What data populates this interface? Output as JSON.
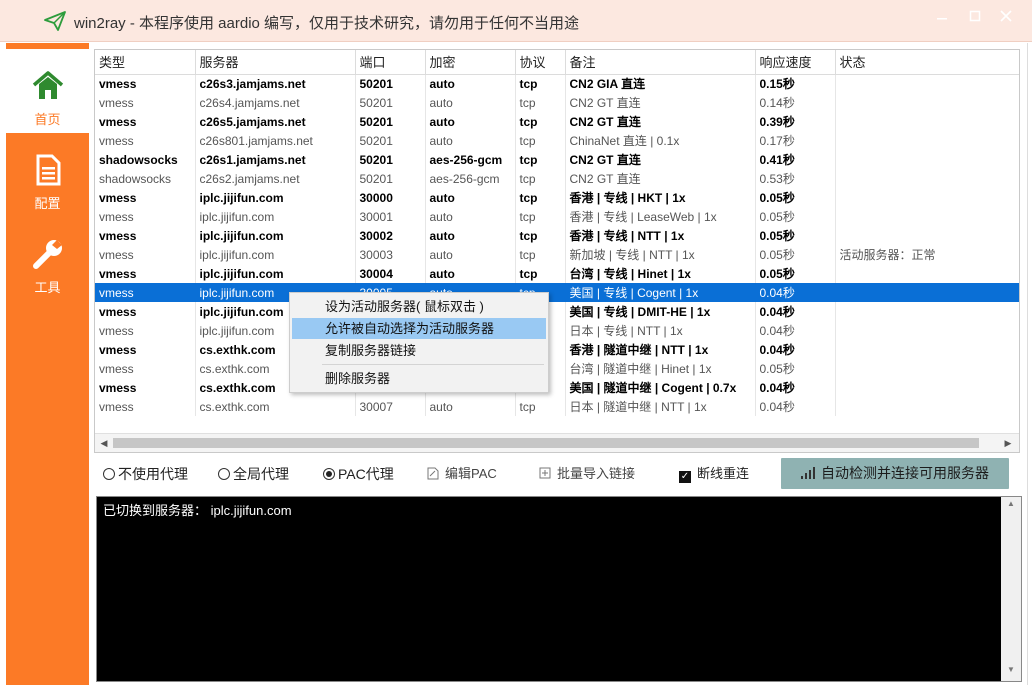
{
  "window": {
    "title": "win2ray - 本程序使用 aardio 编写，仅用于技术研究，请勿用于任何不当用途",
    "min_icon": "minimize-icon",
    "max_icon": "maximize-icon",
    "close_icon": "close-icon",
    "accent": "#fc7a26"
  },
  "sidebar": {
    "items": [
      {
        "label": "首页",
        "icon": "home-icon",
        "active": true
      },
      {
        "label": "配置",
        "icon": "document-icon",
        "active": false
      },
      {
        "label": "工具",
        "icon": "wrench-icon",
        "active": false
      }
    ]
  },
  "table": {
    "columns": [
      "类型",
      "服务器",
      "端口",
      "加密",
      "协议",
      "备注",
      "响应速度",
      "状态"
    ],
    "rows": [
      [
        "vmess",
        "c26s3.jamjams.net",
        "50201",
        "auto",
        "tcp",
        "CN2 GIA 直连",
        "0.15秒",
        ""
      ],
      [
        "vmess",
        "c26s4.jamjams.net",
        "50201",
        "auto",
        "tcp",
        "CN2 GT 直连",
        "0.14秒",
        ""
      ],
      [
        "vmess",
        "c26s5.jamjams.net",
        "50201",
        "auto",
        "tcp",
        "CN2 GT 直连",
        "0.39秒",
        ""
      ],
      [
        "vmess",
        "c26s801.jamjams.net",
        "50201",
        "auto",
        "tcp",
        "ChinaNet 直连 | 0.1x",
        "0.17秒",
        ""
      ],
      [
        "shadowsocks",
        "c26s1.jamjams.net",
        "50201",
        "aes-256-gcm",
        "tcp",
        "CN2 GT 直连",
        "0.41秒",
        ""
      ],
      [
        "shadowsocks",
        "c26s2.jamjams.net",
        "50201",
        "aes-256-gcm",
        "tcp",
        "CN2 GT 直连",
        "0.53秒",
        ""
      ],
      [
        "vmess",
        "iplc.jijifun.com",
        "30000",
        "auto",
        "tcp",
        "香港 | 专线 | HKT | 1x",
        "0.05秒",
        ""
      ],
      [
        "vmess",
        "iplc.jijifun.com",
        "30001",
        "auto",
        "tcp",
        "香港 | 专线 | LeaseWeb | 1x",
        "0.05秒",
        ""
      ],
      [
        "vmess",
        "iplc.jijifun.com",
        "30002",
        "auto",
        "tcp",
        "香港 | 专线 | NTT | 1x",
        "0.05秒",
        ""
      ],
      [
        "vmess",
        "iplc.jijifun.com",
        "30003",
        "auto",
        "tcp",
        "新加坡 | 专线 | NTT | 1x",
        "0.05秒",
        "活动服务器：正常"
      ],
      [
        "vmess",
        "iplc.jijifun.com",
        "30004",
        "auto",
        "tcp",
        "台湾 | 专线 | Hinet | 1x",
        "0.05秒",
        ""
      ],
      [
        "vmess",
        "iplc.jijifun.com",
        "30005",
        "auto",
        "tcp",
        "美国 | 专线 | Cogent | 1x",
        "0.04秒",
        ""
      ],
      [
        "vmess",
        "iplc.jijifun.com",
        "",
        "",
        "",
        "美国 | 专线 | DMIT-HE | 1x",
        "0.04秒",
        ""
      ],
      [
        "vmess",
        "iplc.jijifun.com",
        "",
        "",
        "",
        "日本 | 专线 | NTT | 1x",
        "0.04秒",
        ""
      ],
      [
        "vmess",
        "cs.exthk.com",
        "",
        "",
        "",
        "香港 | 隧道中继 | NTT | 1x",
        "0.04秒",
        ""
      ],
      [
        "vmess",
        "cs.exthk.com",
        "",
        "",
        "",
        "台湾 | 隧道中继 | Hinet | 1x",
        "0.05秒",
        ""
      ],
      [
        "vmess",
        "cs.exthk.com",
        "",
        "",
        "",
        "美国 | 隧道中继 | Cogent | 0.7x",
        "0.04秒",
        ""
      ],
      [
        "vmess",
        "cs.exthk.com",
        "30007",
        "auto",
        "tcp",
        "日本 | 隧道中继 | NTT | 1x",
        "0.04秒",
        ""
      ]
    ],
    "bold_rows": [
      0,
      2,
      4,
      6,
      8,
      10,
      12,
      14,
      16
    ],
    "selected_row": 11
  },
  "context_menu": {
    "items": [
      "设为活动服务器( 鼠标双击 )",
      "允许被自动选择为活动服务器",
      "复制服务器链接",
      "删除服务器"
    ],
    "hover_index": 1
  },
  "options": {
    "no_proxy": "不使用代理",
    "global_proxy": "全局代理",
    "pac_proxy": "PAC代理",
    "selected": "pac",
    "edit_pac": "编辑PAC",
    "batch_import": "批量导入链接",
    "reconnect": "断线重连",
    "reconnect_checked": true,
    "auto_detect": "自动检测并连接可用服务器"
  },
  "log": {
    "text": "已切换到服务器：  iplc.jijifun.com"
  }
}
